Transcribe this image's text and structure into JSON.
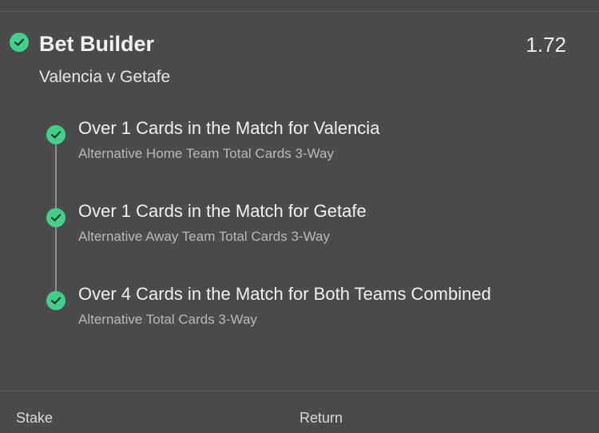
{
  "colors": {
    "background": "#4b4b4b",
    "accent": "#3fd08a",
    "divider": "#5d5d5d"
  },
  "bet": {
    "title": "Bet Builder",
    "odds": "1.72",
    "match": "Valencia v Getafe",
    "status_icon": "check-circle-icon",
    "selections": [
      {
        "title": "Over 1 Cards in the Match for Valencia",
        "market": "Alternative Home Team Total Cards 3-Way",
        "status_icon": "check-circle-icon"
      },
      {
        "title": "Over 1 Cards in the Match for Getafe",
        "market": "Alternative Away Team Total Cards 3-Way",
        "status_icon": "check-circle-icon"
      },
      {
        "title": "Over 4 Cards in the Match for Both Teams Combined",
        "market": "Alternative Total Cards 3-Way",
        "status_icon": "check-circle-icon"
      }
    ]
  },
  "footer": {
    "stake_label": "Stake",
    "return_label": "Return"
  }
}
